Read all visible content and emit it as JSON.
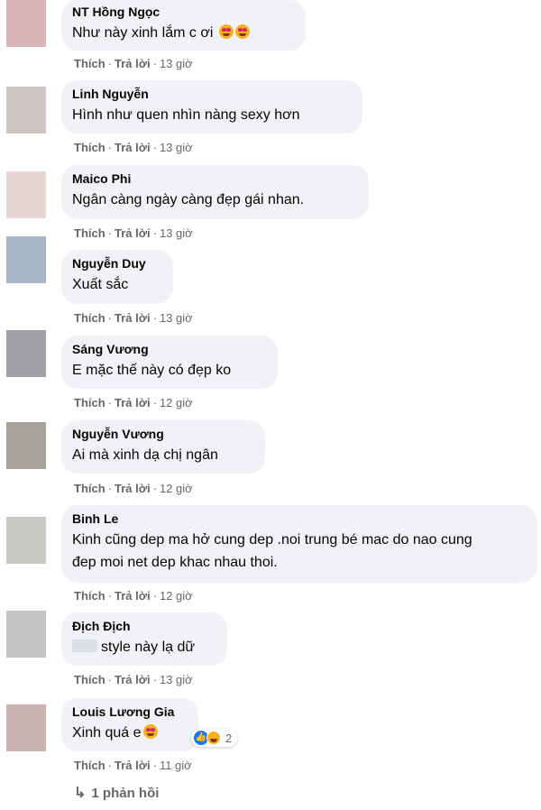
{
  "actions": {
    "like": "Thích",
    "reply": "Trả lời",
    "separator": "·"
  },
  "comments": [
    {
      "author": "NT Hồng Ngọc",
      "text": "Như này xinh lắm c ơi",
      "time": "13 giờ",
      "avatar_color": "#d9b5b8"
    },
    {
      "author": "Linh Nguyễn",
      "text": "Hình như quen nhìn nàng sexy hơn",
      "time": "13 giờ",
      "avatar_color": "#cfc4c2"
    },
    {
      "author": "Maico Phi",
      "text": "Ngân càng ngày càng đẹp gái nhan.",
      "time": "13 giờ",
      "avatar_color": "#e7d6d3"
    },
    {
      "author": "Nguyễn Duy",
      "text": "Xuất sắc",
      "time": "13 giờ",
      "avatar_color": "#a9b4c6"
    },
    {
      "author": "Sáng Vương",
      "text": "E mặc thế này có đẹp ko",
      "time": "12 giờ",
      "avatar_color": "#9fa1a4"
    },
    {
      "author": "Nguyễn Vương",
      "text": "Ai mà xinh dạ chị ngân",
      "time": "12 giờ",
      "avatar_color": "#a7a39a"
    },
    {
      "author": "Binh Le",
      "text": "Kinh cũng dep ma hở cung dep .noi trung bé mac do nao cung đep moi net dep khac nhau thoi.",
      "time": "12 giờ",
      "avatar_color": "#c7c9c4"
    },
    {
      "author": "Địch Địch",
      "text": "style này lạ dữ",
      "time": "13 giờ",
      "avatar_color": "#c4c4c4"
    },
    {
      "author": "Louis Lương Gia",
      "text": "Xinh quá e",
      "time": "11 giờ",
      "avatar_color": "#c9b3b0"
    }
  ],
  "reactions": {
    "count": "2",
    "types": [
      "like-icon",
      "haha-icon"
    ],
    "like_color": "#1877f2"
  },
  "view_replies": "1 phản hồi",
  "colors": {
    "bubble": "#f0f2f5",
    "meta_text": "#65676b",
    "text": "#050505"
  }
}
